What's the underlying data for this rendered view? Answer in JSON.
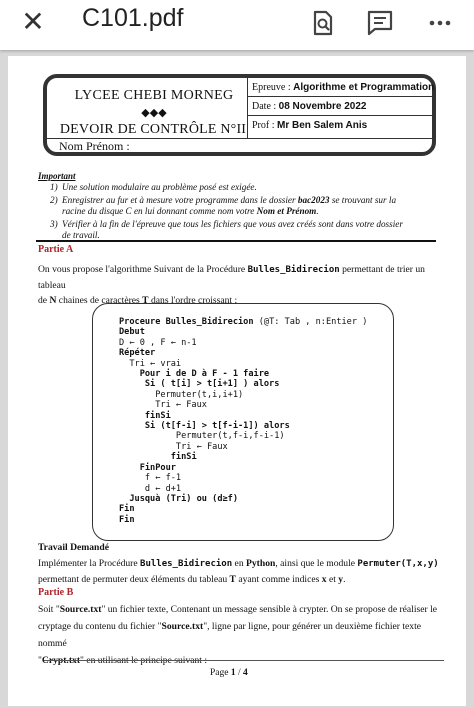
{
  "app": {
    "title": "C101.pdf",
    "close_icon": "close-icon",
    "search_icon": "search-in-document-icon",
    "comment_icon": "comment-icon",
    "more_icon": "more-options-icon"
  },
  "header": {
    "school": "LYCEE CHEBI MORNEG",
    "diamonds": "◆◆◆",
    "exam": "DEVOIR DE CONTRÔLE N°II",
    "epreuve_label": "Epreuve : ",
    "epreuve_value": "Algorithme et Programmation",
    "date_label": "Date : ",
    "date_value": "08 Novembre 2022",
    "prof_label": "Prof : ",
    "prof_value": "Mr Ben Salem Anis",
    "nom": "Nom Prénom :"
  },
  "important": {
    "label": "Important",
    "items": [
      {
        "n": "1)",
        "text": "Une solution modulaire au problème posé est exigée."
      },
      {
        "n": "2)",
        "text_a": "Enregistrer au fur et à mesure votre programme dans le dossier ",
        "bold_a": "bac2023",
        "text_b": " se trouvant sur la racine du disque C en lui donnant comme nom votre ",
        "bold_b": "Nom et Prénom",
        "text_c": "."
      },
      {
        "n": "3)",
        "text": "Vérifier à la fin de l'épreuve que tous les fichiers que vous avez créés sont dans votre dossier de travail."
      }
    ]
  },
  "partie_a": {
    "title": "Partie A",
    "intro_a": "On vous propose l'algorithme Suivant de la Procédure ",
    "intro_code": "Bulles_Bidirecion",
    "intro_b": " permettant de trier un tableau",
    "intro_c": "de ",
    "intro_n": "N",
    "intro_d": " chaines de caractères ",
    "intro_t": "T",
    "intro_e": " dans l'ordre croissant :"
  },
  "algo": {
    "l1_kw": "Proceure ",
    "l1_name": "Bulles_Bidirecion",
    "l1_rest": " (@T: Tab , n:Entier )",
    "l2": "Debut",
    "l3": "D ← 0 , F ← n-1",
    "l4": "Répéter",
    "l5": "Tri ← vrai",
    "l6": "Pour i de D à F - 1 faire",
    "l7": "Si ( t[i] > t[i+1] ) alors",
    "l8": "Permuter(t,i,i+1)",
    "l9": "Tri ← Faux",
    "l10": "finSi",
    "l11": "Si (t[f-i] > t[f-i-1]) alors",
    "l12": "Permuter(t,f-i,f-i-1)",
    "l13": "Tri ← Faux",
    "l14": "finSi",
    "l15": "FinPour",
    "l16": "f ← f-1",
    "l17": "d ← d+1",
    "l18": "Jusquà (Tri) ou (d≥f)",
    "l19": "Fin",
    "l20": "Fin"
  },
  "travail": {
    "title": "Travail Demandé",
    "t1": "Implémenter la Procédure ",
    "t1_code": "Bulles_Bidirecion",
    "t1_b": " en ",
    "t1_py": "Python",
    "t1_c": ", ainsi que le module ",
    "t1_mod": "Permuter(T,x,y)",
    "t2_a": "permettant de permuter deux éléments du tableau ",
    "t2_t": "T",
    "t2_b": " ayant comme indices ",
    "t2_x": "x",
    "t2_c": "  et ",
    "t2_y": "y",
    "t2_d": "."
  },
  "partie_b": {
    "title": "Partie B",
    "p1_a": "Soit \"",
    "p1_file": "Source.txt",
    "p1_b": "\" un fichier texte, Contenant un message sensible à crypter. On se propose de réaliser le",
    "p2_a": "cryptage du contenu du fichier \"",
    "p2_file": "Source.txt",
    "p2_b": "\", ligne par ligne, pour générer un deuxième fichier texte nommé",
    "p3_a": "\"",
    "p3_file": "Crypt.txt",
    "p3_b": "\" en utilisant le principe suivant :"
  },
  "footer": {
    "page_label": "Page ",
    "page_current": "1",
    "page_sep": " / ",
    "page_total": "4"
  }
}
